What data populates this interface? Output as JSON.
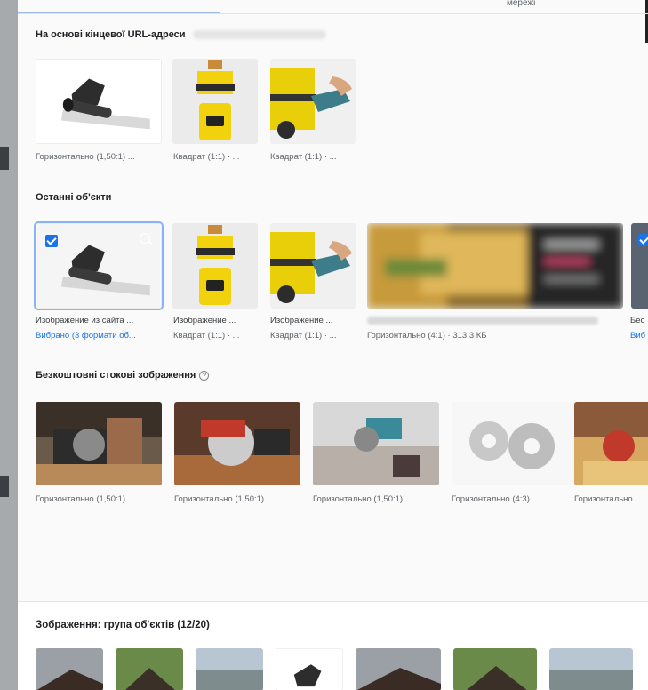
{
  "tabs": {
    "network_label": "мережі"
  },
  "section_url": {
    "title": "На основі кінцевої URL-адреси",
    "items": [
      {
        "caption": "Горизонтально (1,50:1) ..."
      },
      {
        "caption": "Квадрат (1:1) · ..."
      },
      {
        "caption": "Квадрат (1:1) · ..."
      }
    ]
  },
  "section_recent": {
    "title": "Останні об'єкти",
    "items": [
      {
        "title": "Изображение из сайта ...",
        "status": "Вибрано (3 формати об..."
      },
      {
        "title": "Изображение ...",
        "status": "Квадрат (1:1) · ..."
      },
      {
        "title": "Изображение ...",
        "status": "Квадрат (1:1) · ..."
      },
      {
        "title": "",
        "status": "Горизонтально (4:1) · 313,3 КБ"
      },
      {
        "title": "Бес",
        "status": "Виб"
      }
    ]
  },
  "section_stock": {
    "title": "Безкоштовні стокові зображення",
    "help_icon": "help-circle-icon",
    "items": [
      {
        "caption": "Горизонтально (1,50:1) ..."
      },
      {
        "caption": "Горизонтально (1,50:1) ..."
      },
      {
        "caption": "Горизонтально (1,50:1) ..."
      },
      {
        "caption": "Горизонтально (4:3) ..."
      },
      {
        "caption": "Горизонтально"
      }
    ]
  },
  "group": {
    "title": "Зображення: група об'єктів (12/20)"
  },
  "colors": {
    "accent": "#1a73e8",
    "selected_outline": "#8ab4f8",
    "panel_bg": "#fafafa",
    "backdrop": "#8a8d90"
  }
}
